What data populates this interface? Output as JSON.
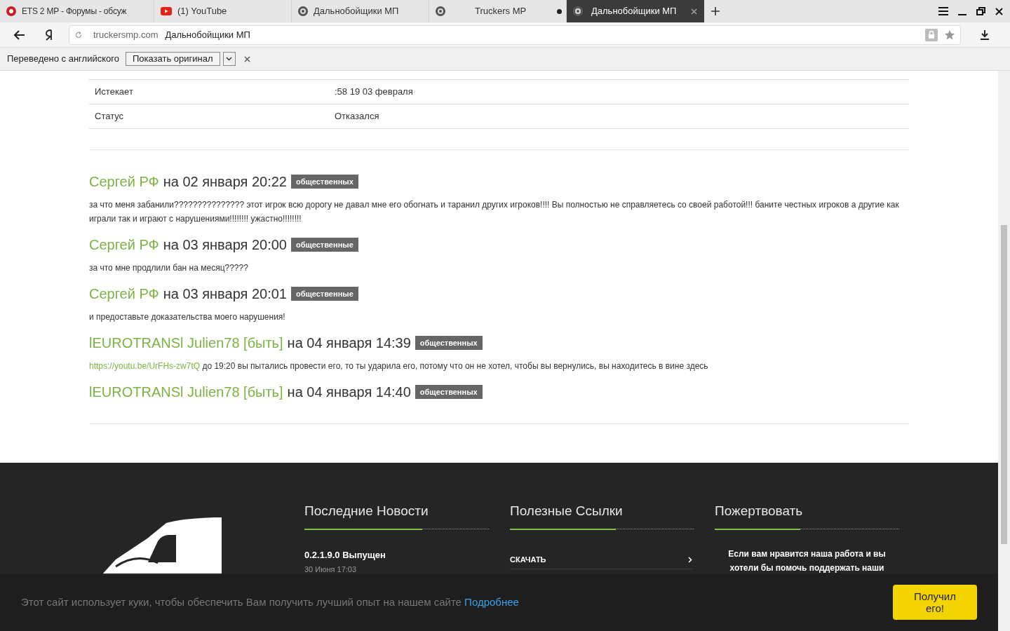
{
  "tabs": [
    {
      "title": "ETS 2 MP - Форумы - обсуж",
      "selected": false,
      "dot": false
    },
    {
      "title": "(1) YouTube",
      "selected": false,
      "dot": false
    },
    {
      "title": "Дальнобойщики МП",
      "selected": false,
      "dot": false
    },
    {
      "title": "Truckers MP",
      "selected": false,
      "dot": true
    },
    {
      "title": "Дальнобойщики МП",
      "selected": true,
      "dot": false
    }
  ],
  "address": {
    "domain": "truckersmp.com",
    "page_title": "Дальнобойщики МП"
  },
  "translate_bar": {
    "label": "Переведено с английского",
    "button": "Показать оригинал"
  },
  "details": [
    {
      "label": "Истекает",
      "value": ":58 19 03 февраля"
    },
    {
      "label": "Статус",
      "value": "Отказался"
    }
  ],
  "comments": [
    {
      "author": "Сергей РФ",
      "when": "на 02 января 20:22",
      "tag": "общественных",
      "text": "за что меня забанили??????????????? этот игрок всю дорогу не давал мне его обогнать и таранил других игроков!!!! Вы полностью не справляетесь со своей работой!!! баните честных игроков а другие как играли так и играют с нарушениями!!!!!!!! ужастно!!!!!!!!"
    },
    {
      "author": "Сергей РФ",
      "when": "на 03 января 20:00",
      "tag": "общественные",
      "text": "за что мне продлили бан на месяц?????"
    },
    {
      "author": "Сергей РФ",
      "when": "на 03 января 20:01",
      "tag": "общественные",
      "text": "и предоставьте доказательства моего нарушения!"
    },
    {
      "author": "lEUROTRANSl Julien78 [быть]",
      "when": "на 04 января 14:39",
      "tag": "общественных",
      "link": "https://youtu.be/UrFHs-zw7tQ",
      "text": "до 19:20 вы пытались провести его, то ты ударила его, потому что он не хотел, чтобы вы вернулись, вы находитесь в вине здесь"
    },
    {
      "author": "lEUROTRANSl Julien78 [быть]",
      "when": "на 04 января 14:40",
      "tag": "общественных"
    }
  ],
  "footer": {
    "news": {
      "heading": "Последние Новости",
      "items": [
        {
          "title": "0.2.1.9.0 Выпущен",
          "date": "30 Июня 17:03"
        }
      ]
    },
    "links": {
      "heading": "Полезные Ссылки",
      "items": [
        "СКАЧАТЬ"
      ]
    },
    "donate": {
      "heading": "Пожертвовать",
      "text": "Если вам нравится наша работа и вы хотели бы помочь поддержать наши"
    }
  },
  "cookie": {
    "text": "Этот сайт использует куки, чтобы обеспечить Вам получить лучший опыт на нашем сайте",
    "link": "Подробнее",
    "button": "Получил его!"
  }
}
